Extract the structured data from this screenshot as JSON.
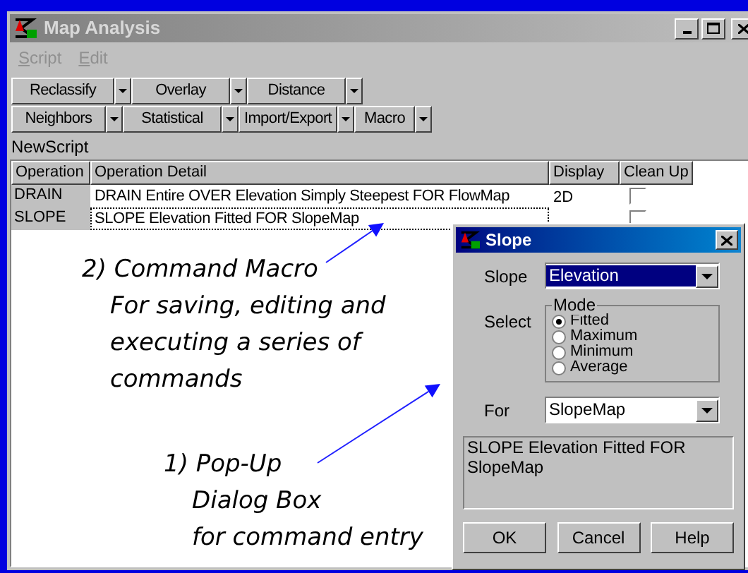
{
  "window": {
    "title": "Map Analysis"
  },
  "menu": [
    {
      "label": "Script",
      "disabled": true
    },
    {
      "label": "Edit",
      "disabled": true
    }
  ],
  "toolbar": [
    [
      {
        "label": "Reclassify"
      },
      {
        "label": "Overlay"
      },
      {
        "label": "Distance"
      }
    ],
    [
      {
        "label": "Neighbors"
      },
      {
        "label": "Statistical"
      },
      {
        "label": "Import/Export"
      },
      {
        "label": "Macro"
      }
    ]
  ],
  "script_label": "NewScript",
  "table": {
    "columns": [
      "Operation",
      "Operation Detail",
      "Display",
      "Clean Up"
    ],
    "rows": [
      {
        "operation": "DRAIN",
        "detail": "DRAIN Entire OVER Elevation Simply Steepest FOR FlowMap",
        "display": "2D",
        "clean_up": false,
        "selected": false
      },
      {
        "operation": "SLOPE",
        "detail": "SLOPE Elevation Fitted FOR SlopeMap",
        "clean_up": false,
        "selected": true
      }
    ]
  },
  "annotations": [
    {
      "heading": "2) Command Macro",
      "lines": [
        "For saving, editing and",
        "executing a series of",
        "commands"
      ]
    },
    {
      "heading": "1) Pop-Up",
      "lines": [
        "Dialog Box",
        "for command entry"
      ]
    }
  ],
  "dialog": {
    "title": "Slope",
    "slope_label": "Slope",
    "slope_value": "Elevation",
    "select_label": "Select",
    "mode_title": "Mode",
    "modes": [
      {
        "label": "Fitted",
        "selected": true
      },
      {
        "label": "Maximum",
        "selected": false
      },
      {
        "label": "Minimum",
        "selected": false
      },
      {
        "label": "Average",
        "selected": false
      }
    ],
    "for_label": "For",
    "for_value": "SlopeMap",
    "preview": "SLOPE Elevation Fitted FOR SlopeMap",
    "buttons": [
      "OK",
      "Cancel",
      "Help"
    ]
  }
}
